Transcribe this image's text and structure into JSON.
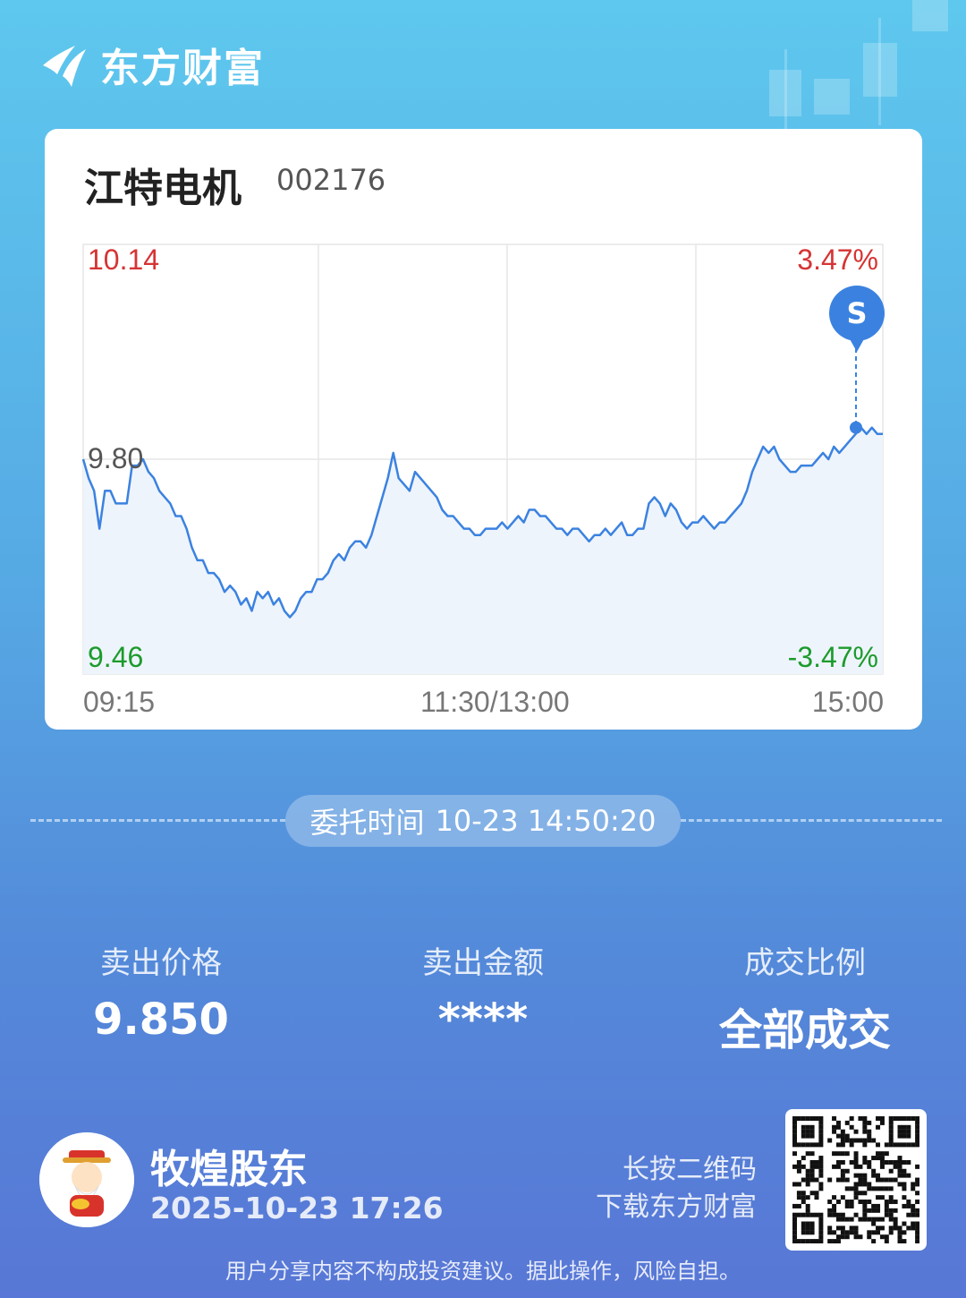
{
  "brand": {
    "name": "东方财富"
  },
  "stock": {
    "name": "江特电机",
    "code": "002176"
  },
  "chart_data": {
    "type": "line",
    "y_max_label": "10.14",
    "y_mid_label": "9.80",
    "y_min_label": "9.46",
    "pct_max_label": "3.47%",
    "pct_min_label": "-3.47%",
    "x_tick_labels": [
      "09:15",
      "11:30/13:00",
      "15:00"
    ],
    "ylim": [
      9.46,
      10.14
    ],
    "reference_price": 9.8,
    "grid": true,
    "marker": {
      "label": "S",
      "price": 9.85
    },
    "series": [
      {
        "values": [
          9.8,
          9.77,
          9.75,
          9.69,
          9.75,
          9.75,
          9.73,
          9.73,
          9.73,
          9.79,
          9.79,
          9.8,
          9.78,
          9.77,
          9.75,
          9.74,
          9.73,
          9.71,
          9.71,
          9.69,
          9.66,
          9.64,
          9.64,
          9.62,
          9.62,
          9.61,
          9.59,
          9.6,
          9.59,
          9.57,
          9.58,
          9.56,
          9.59,
          9.58,
          9.59,
          9.57,
          9.58,
          9.56,
          9.55,
          9.56,
          9.58,
          9.59,
          9.59,
          9.61,
          9.61,
          9.62,
          9.64,
          9.65,
          9.64,
          9.66,
          9.67,
          9.67,
          9.66,
          9.68,
          9.71,
          9.74,
          9.77,
          9.81,
          9.77,
          9.76,
          9.75,
          9.78,
          9.77,
          9.76,
          9.75,
          9.74,
          9.72,
          9.71,
          9.71,
          9.7,
          9.69,
          9.69,
          9.68,
          9.68,
          9.69,
          9.69,
          9.69,
          9.7,
          9.69,
          9.7,
          9.71,
          9.7,
          9.72,
          9.72,
          9.71,
          9.71,
          9.7,
          9.69,
          9.69,
          9.68,
          9.69,
          9.69,
          9.68,
          9.67,
          9.68,
          9.68,
          9.69,
          9.68,
          9.69,
          9.7,
          9.68,
          9.68,
          9.69,
          9.69,
          9.73,
          9.74,
          9.73,
          9.71,
          9.73,
          9.72,
          9.7,
          9.69,
          9.7,
          9.7,
          9.71,
          9.7,
          9.69,
          9.7,
          9.7,
          9.71,
          9.72,
          9.73,
          9.75,
          9.78,
          9.8,
          9.82,
          9.81,
          9.82,
          9.8,
          9.79,
          9.78,
          9.78,
          9.79,
          9.79,
          9.79,
          9.8,
          9.81,
          9.8,
          9.82,
          9.81,
          9.82,
          9.83,
          9.84,
          9.85,
          9.84,
          9.85,
          9.84,
          9.84
        ]
      }
    ]
  },
  "order": {
    "time_label": "委托时间",
    "time_value": "10-23 14:50:20"
  },
  "stats": [
    {
      "label": "卖出价格",
      "value": "9.850"
    },
    {
      "label": "卖出金额",
      "value": "****"
    },
    {
      "label": "成交比例",
      "value": "全部成交"
    }
  ],
  "user": {
    "name": "牧煌股东",
    "datetime": "2025-10-23 17:26"
  },
  "qr_hint": {
    "line1": "长按二维码",
    "line2": "下载东方财富"
  },
  "disclaimer": "用户分享内容不构成投资建议。据此操作，风险自担。",
  "colors": {
    "up": "#d63434",
    "down": "#1c9b2c",
    "line": "#3b82e0",
    "fill": "#eef4fc"
  }
}
